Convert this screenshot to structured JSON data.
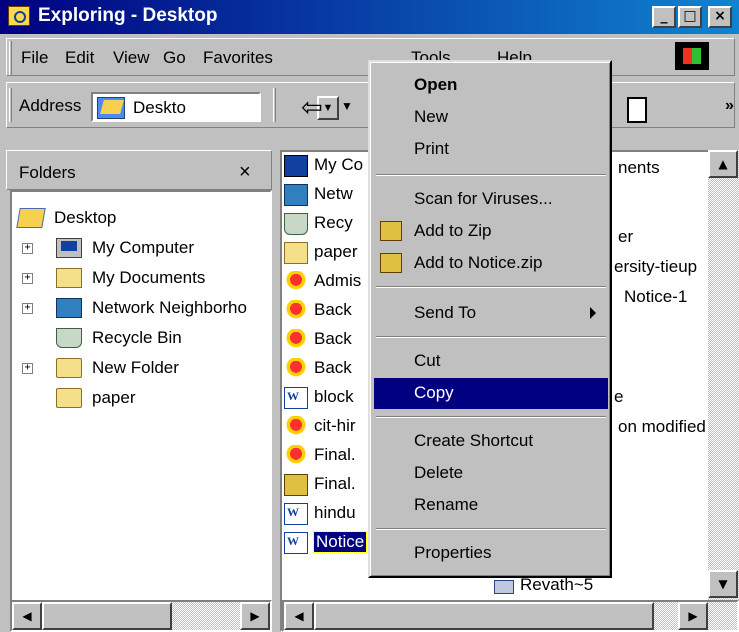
{
  "window": {
    "title": "Exploring - Desktop",
    "min": "_",
    "max": "□",
    "close": "×"
  },
  "menubar": [
    "File",
    "Edit",
    "View",
    "Go",
    "Favorites",
    "Tools",
    "Help"
  ],
  "address": {
    "label": "Address",
    "value": "Deskto"
  },
  "toolbar": {
    "chevron": "»"
  },
  "folders": {
    "title": "Folders",
    "close": "×",
    "tree": [
      {
        "label": "Desktop",
        "icon": "desktop-icon"
      },
      {
        "label": "My Computer",
        "icon": "computer-icon",
        "expander": "+"
      },
      {
        "label": "My Documents",
        "icon": "documents-folder-icon",
        "expander": "+"
      },
      {
        "label": "Network Neighborho",
        "icon": "network-icon",
        "expander": "+"
      },
      {
        "label": "Recycle Bin",
        "icon": "recycle-bin-icon"
      },
      {
        "label": "New Folder",
        "icon": "folder-icon",
        "expander": "+"
      },
      {
        "label": "paper",
        "icon": "folder-icon"
      }
    ]
  },
  "files_left": [
    {
      "name": "My Co",
      "icon": "computer-icon"
    },
    {
      "name": "Netw",
      "icon": "network-icon"
    },
    {
      "name": "Recy",
      "icon": "recycle-bin-icon"
    },
    {
      "name": "paper",
      "icon": "folder-icon"
    },
    {
      "name": "Admis",
      "icon": "balloon-icon"
    },
    {
      "name": "Back",
      "icon": "balloon-icon"
    },
    {
      "name": "Back",
      "icon": "balloon-icon"
    },
    {
      "name": "Back",
      "icon": "balloon-icon"
    },
    {
      "name": "block",
      "icon": "word-doc-icon"
    },
    {
      "name": "cit-hir",
      "icon": "balloon-icon"
    },
    {
      "name": "Final.",
      "icon": "balloon-icon"
    },
    {
      "name": "Final.",
      "icon": "powerpoint-icon"
    },
    {
      "name": "hindu",
      "icon": "word-doc-icon"
    },
    {
      "name": "Notice",
      "icon": "word-doc-icon",
      "selected": true
    }
  ],
  "files_right": [
    {
      "name": "nents"
    },
    {
      "name": "er"
    },
    {
      "name": "ersity-tieup"
    },
    {
      "name": "Notice-1"
    },
    {
      "name": "e"
    },
    {
      "name": "on modified"
    },
    {
      "name": "Revath~5",
      "icon": "psd-icon"
    }
  ],
  "context_menu": {
    "items": [
      {
        "label": "Open",
        "bold": true
      },
      {
        "label": "New"
      },
      {
        "label": "Print"
      },
      {
        "sep": true
      },
      {
        "label": "Scan for Viruses..."
      },
      {
        "label": "Add to Zip",
        "icon": "winzip-icon"
      },
      {
        "label": "Add to Notice.zip",
        "icon": "winzip-icon"
      },
      {
        "sep": true
      },
      {
        "label": "Send To",
        "submenu": true
      },
      {
        "sep": true
      },
      {
        "label": "Cut"
      },
      {
        "label": "Copy",
        "highlighted": true
      },
      {
        "sep": true
      },
      {
        "label": "Create Shortcut"
      },
      {
        "label": "Delete"
      },
      {
        "label": "Rename"
      },
      {
        "sep": true
      },
      {
        "label": "Properties"
      }
    ]
  }
}
